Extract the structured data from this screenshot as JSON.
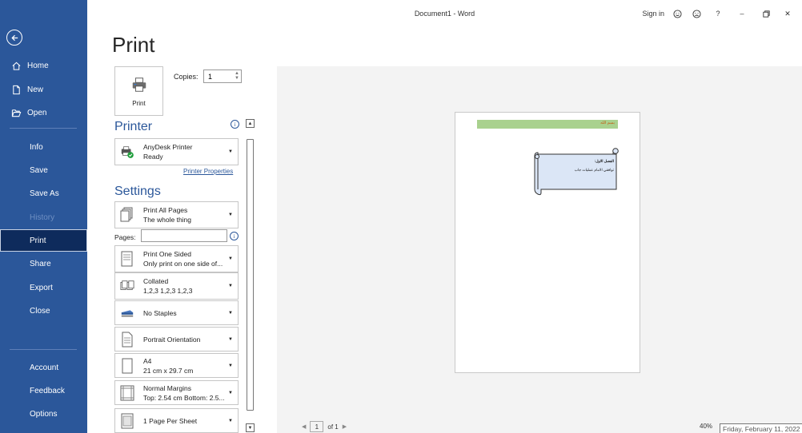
{
  "titlebar": {
    "doc_title": "Document1  -  Word",
    "sign_in": "Sign in",
    "help": "?",
    "minimize": "–",
    "close": "✕"
  },
  "sidebar": {
    "back_icon": "arrow-left-circle-icon",
    "items": [
      {
        "label": "Home",
        "icon": "home-icon"
      },
      {
        "label": "New",
        "icon": "new-document-icon"
      },
      {
        "label": "Open",
        "icon": "open-folder-icon"
      },
      {
        "label": "Info"
      },
      {
        "label": "Save"
      },
      {
        "label": "Save As"
      },
      {
        "label": "History"
      },
      {
        "label": "Print"
      },
      {
        "label": "Share"
      },
      {
        "label": "Export"
      },
      {
        "label": "Close"
      },
      {
        "label": "Account"
      },
      {
        "label": "Feedback"
      },
      {
        "label": "Options"
      }
    ],
    "active": "Print",
    "accent_color": "#2b579a"
  },
  "print_panel": {
    "heading": "Print",
    "print_button_label": "Print",
    "copies_label": "Copies:",
    "copies_value": "1",
    "printer_heading": "Printer",
    "printer_name": "AnyDesk Printer",
    "printer_status": "Ready",
    "printer_properties": "Printer Properties",
    "settings_heading": "Settings",
    "info_glyph": "i",
    "pages_label": "Pages:",
    "pages_value": "",
    "settings": [
      {
        "line1": "Print All Pages",
        "line2": "The whole thing"
      },
      {
        "line1": "Print One Sided",
        "line2": "Only print on one side of..."
      },
      {
        "line1": "Collated",
        "line2": "1,2,3   1,2,3   1,2,3"
      },
      {
        "line1": "No Staples",
        "line2": ""
      },
      {
        "line1": "Portrait Orientation",
        "line2": ""
      },
      {
        "line1": "A4",
        "line2": "21 cm x 29.7 cm"
      },
      {
        "line1": "Normal Margins",
        "line2": "Top: 2.54 cm Bottom: 2.5..."
      },
      {
        "line1": "1 Page Per Sheet",
        "line2": ""
      }
    ]
  },
  "preview": {
    "header_text": "بسم الله",
    "scroll_line1": "الفصل الاول:",
    "scroll_line2": "توافقي الامام عمليات جاب",
    "current_page": "1",
    "page_of": "of 1",
    "zoom": "40%",
    "date_tooltip": "Friday, February 11, 2022"
  }
}
